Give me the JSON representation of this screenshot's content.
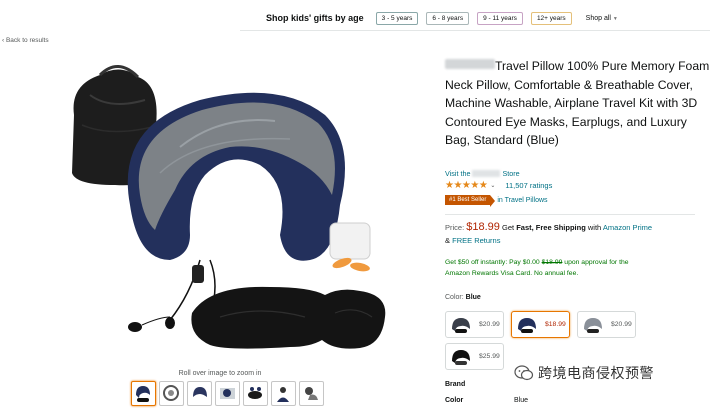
{
  "gift_bar": {
    "title": "Shop kids' gifts by age",
    "ages": [
      "3 - 5 years",
      "6 - 8 years",
      "9 - 11 years",
      "12+ years"
    ],
    "shop_all": "Shop all",
    "age_colors": [
      "#8aa7a8",
      "#aab7b8",
      "#c7a3c4",
      "#e4c07a"
    ]
  },
  "nav": {
    "back": "‹ Back to results"
  },
  "gallery": {
    "zoom_hint": "Roll over image to zoom in",
    "thumbnail_count": 7,
    "selected_thumbnail": 1
  },
  "product": {
    "title": "Travel Pillow 100% Pure Memory Foam Neck Pillow, Comfortable & Breathable Cover, Machine Washable, Airplane Travel Kit with 3D Contoured Eye Masks, Earplugs, and Luxury Bag, Standard (Blue)",
    "store_prefix": "Visit the",
    "store_suffix": "Store",
    "rating_stars": "★★★★★",
    "rating_value": 4.5,
    "ratings_count": "11,507 ratings",
    "best_seller_badge": "#1 Best Seller",
    "best_seller_category": "in Travel Pillows"
  },
  "pricing": {
    "label": "Price:",
    "price": "$18.99",
    "get": "Get",
    "fast_shipping": "Fast, Free Shipping",
    "with": "with",
    "prime": "Amazon Prime",
    "returns_amp": "&",
    "returns": "FREE Returns"
  },
  "offer": {
    "line1_a": "Get $50 off instantly: Pay $0.00",
    "line1_strike": "$18.99",
    "line1_b": "upon approval for the",
    "line2": "Amazon Rewards Visa Card. No annual fee."
  },
  "color": {
    "label": "Color:",
    "value": "Blue",
    "options": [
      {
        "price": "$20.99",
        "selected": false
      },
      {
        "price": "$18.99",
        "selected": true
      },
      {
        "price": "$20.99",
        "selected": false
      },
      {
        "price": "$25.99",
        "selected": false
      }
    ]
  },
  "specs": {
    "brand_label": "Brand",
    "color_label": "Color",
    "color_value": "Blue"
  },
  "watermark": {
    "text": "跨境电商侵权预警"
  },
  "colors": {
    "link": "#007185",
    "price": "#b12704",
    "badge": "#c45500",
    "offer": "#007600",
    "star": "#e5881a"
  }
}
